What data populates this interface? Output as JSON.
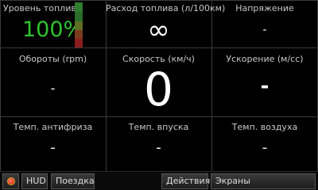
{
  "fuel_level": {
    "label": "Уровень топлива",
    "value": "100%",
    "level_fraction": 1.0
  },
  "fuel_consumption": {
    "label": "Расход топлива (л/100км)",
    "value": "∞"
  },
  "voltage": {
    "label": "Напряжение",
    "value": "-"
  },
  "rpm": {
    "label": "Обороты (rpm)",
    "value": "-"
  },
  "speed": {
    "label": "Скорость (км/ч)",
    "value": "0"
  },
  "acceleration": {
    "label": "Ускорение (м/сс)",
    "value": "-"
  },
  "coolant_temp": {
    "label": "Темп. антифриза",
    "value": "-"
  },
  "intake_temp": {
    "label": "Темп. впуска",
    "value": "-"
  },
  "air_temp": {
    "label": "Темп. воздуха",
    "value": "-"
  },
  "toolbar": {
    "record_icon": "record-icon",
    "hud": "HUD",
    "trip": "Поездка",
    "actions": "Действия",
    "screens": "Экраны"
  },
  "colors": {
    "fuel_value": "#2fc42f",
    "background": "#000000"
  }
}
